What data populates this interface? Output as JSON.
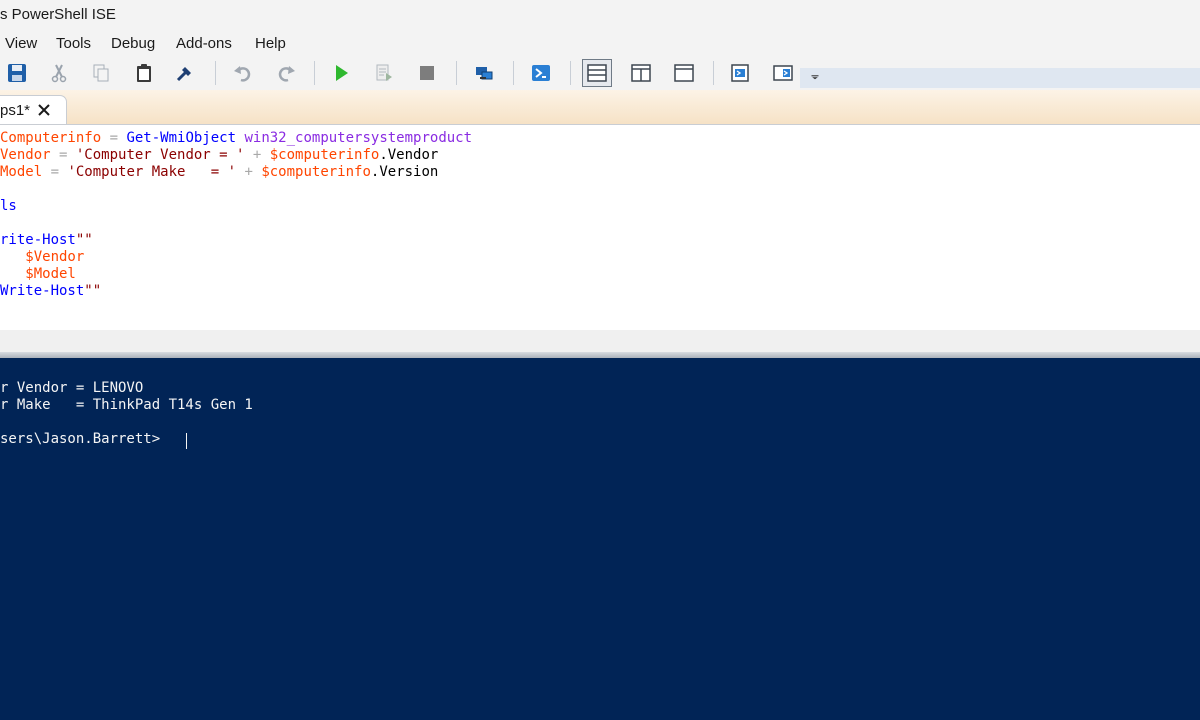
{
  "window": {
    "title": "s PowerShell ISE"
  },
  "menu": {
    "view": "View",
    "tools": "Tools",
    "debug": "Debug",
    "addons": "Add-ons",
    "help": "Help"
  },
  "toolbar": {
    "icons": [
      "save-icon",
      "cut-icon",
      "copy-icon",
      "paste-icon",
      "clear-icon",
      "undo-icon",
      "redo-icon",
      "run-icon",
      "run-selection-icon",
      "stop-icon",
      "remote-powershell-icon",
      "powershell-console-icon",
      "script-pane-top-icon",
      "script-pane-right-icon",
      "script-pane-maximized-icon",
      "show-command-window-icon",
      "show-command-addon-icon",
      "overflow-icon"
    ],
    "colors": {
      "run": "#2eb82e",
      "accent": "#1f6fb5"
    }
  },
  "tab": {
    "label": "ps1*",
    "close_glyph": "✕"
  },
  "editor": {
    "lines": [
      [
        {
          "t": "Computerinfo",
          "c": "var"
        },
        {
          "t": " = ",
          "c": "op"
        },
        {
          "t": "Get-WmiObject",
          "c": "cmd"
        },
        {
          "t": " ",
          "c": "txt"
        },
        {
          "t": "win32_computersystemproduct",
          "c": "arg"
        }
      ],
      [
        {
          "t": "Vendor",
          "c": "var"
        },
        {
          "t": " = ",
          "c": "op"
        },
        {
          "t": "'Computer Vendor = '",
          "c": "str"
        },
        {
          "t": " + ",
          "c": "op"
        },
        {
          "t": "$computerinfo",
          "c": "var"
        },
        {
          "t": ".Vendor",
          "c": "txt"
        }
      ],
      [
        {
          "t": "Model",
          "c": "var"
        },
        {
          "t": " = ",
          "c": "op"
        },
        {
          "t": "'Computer Make   = '",
          "c": "str"
        },
        {
          "t": " + ",
          "c": "op"
        },
        {
          "t": "$computerinfo",
          "c": "var"
        },
        {
          "t": ".Version",
          "c": "txt"
        }
      ],
      [],
      [
        {
          "t": "ls",
          "c": "cmd"
        }
      ],
      [],
      [
        {
          "t": "rite-Host",
          "c": "cmd"
        },
        {
          "t": "\"\"",
          "c": "str"
        }
      ],
      [
        {
          "t": "   $Vendor",
          "c": "var"
        }
      ],
      [
        {
          "t": "   $Model",
          "c": "var"
        }
      ],
      [
        {
          "t": "Write-Host",
          "c": "cmd"
        },
        {
          "t": "\"\"",
          "c": "str"
        }
      ]
    ]
  },
  "console": {
    "lines": [
      "r Vendor = LENOVO",
      "r Make   = ThinkPad T14s Gen 1",
      "",
      "sers\\Jason.Barrett> "
    ],
    "background": "#012456"
  }
}
